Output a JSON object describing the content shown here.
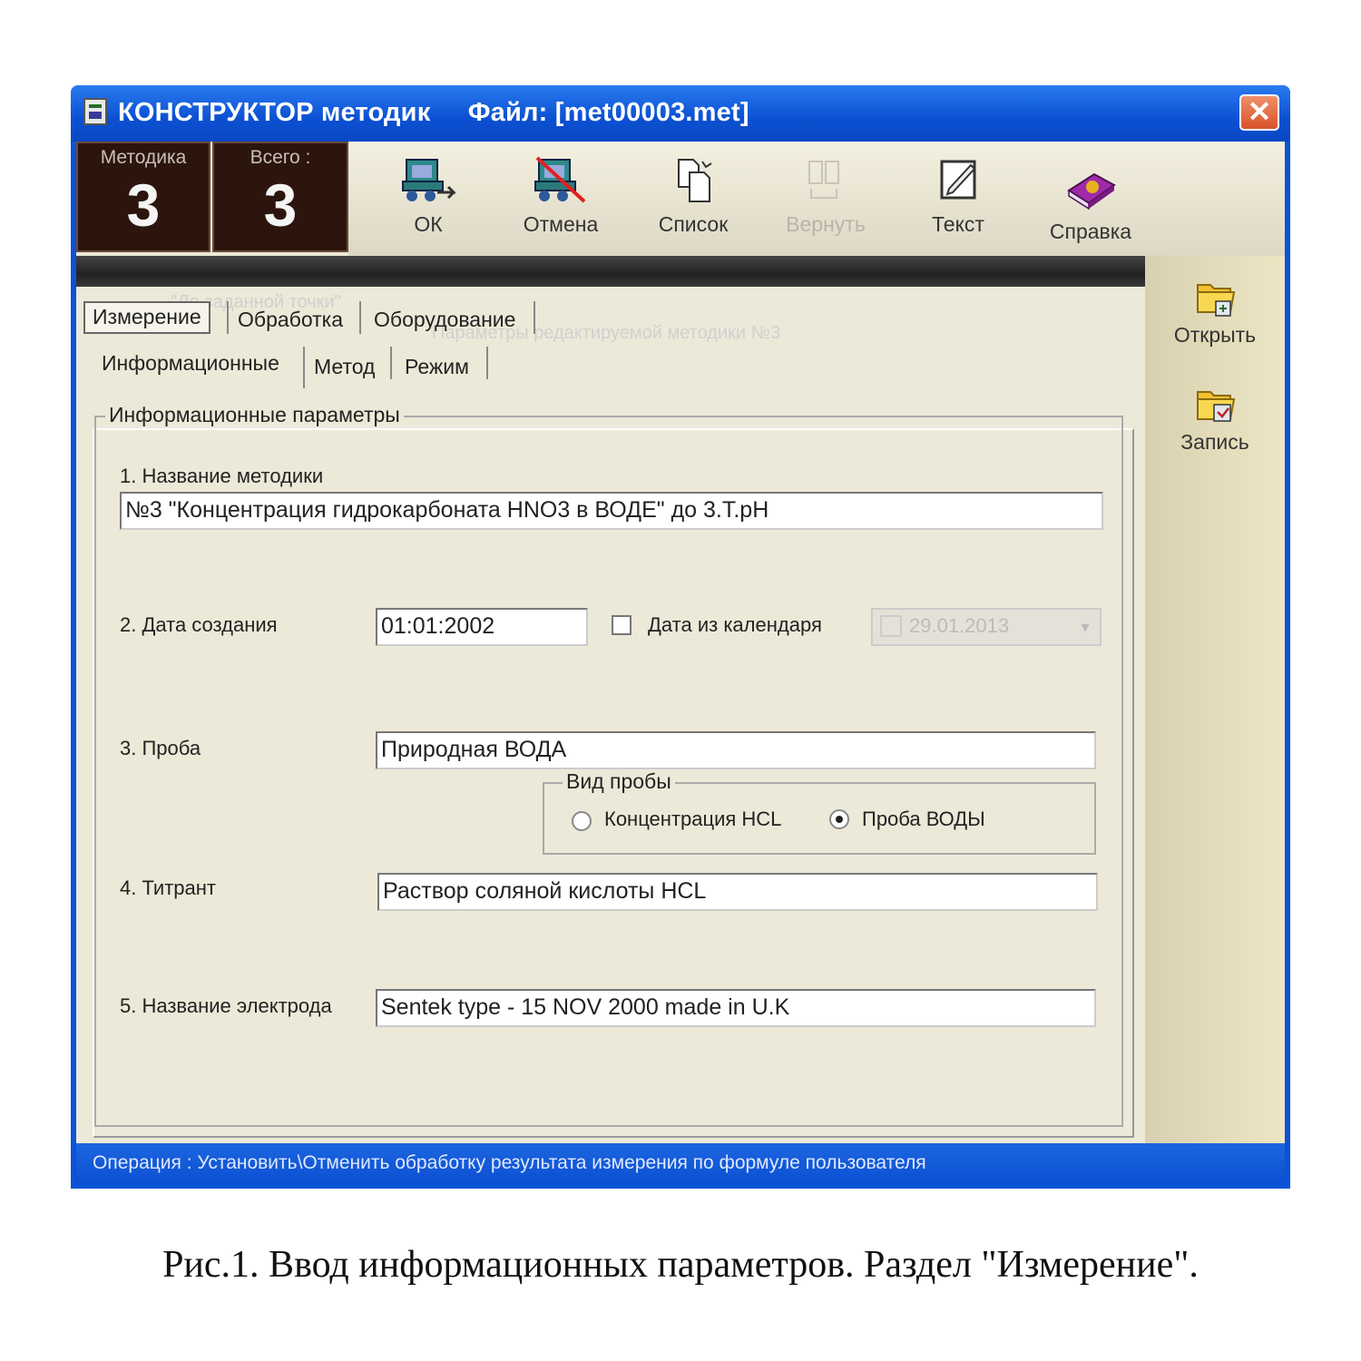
{
  "window": {
    "title": "КОНСТРУКТОР методик     Файл: [met00003.met]",
    "close_glyph": "✕"
  },
  "counters": {
    "method": {
      "label": "Методика",
      "value": "3"
    },
    "total": {
      "label": "Всего :",
      "value": "3"
    }
  },
  "toolbar": {
    "ok": "ОК",
    "cancel": "Отмена",
    "list": "Список",
    "restore": "Вернуть",
    "text": "Текст",
    "help": "Справка"
  },
  "infobar": {
    "mode": "\"До заданной точки\"",
    "text": "Параметры редактируемой методики №3"
  },
  "side": {
    "open": "Открыть",
    "save": "Запись"
  },
  "tabs": {
    "top": [
      "Измерение",
      "Обработка",
      "Оборудование"
    ],
    "sub": [
      "Информационные",
      "Метод",
      "Режим"
    ]
  },
  "form": {
    "group_title": "Информационные параметры",
    "name_label": "1. Название методики",
    "name_value": "№3 \"Концентрация гидрокарбоната HNO3 в ВОДЕ\" до 3.Т.pH",
    "date_label": "2. Дата создания",
    "date_value": "01:01:2002",
    "calendar_label": "Дата из календаря",
    "calendar_value": "29.01.2013",
    "sample_label": "3. Проба",
    "sample_value": "Природная ВОДА",
    "sample_type_title": "Вид пробы",
    "sample_type_options": [
      "Концентрация HCL",
      "Проба ВОДЫ"
    ],
    "titrant_label": "4. Титрант",
    "titrant_value": "Раствор соляной кислоты HCL",
    "electrode_label": "5. Название электрода",
    "electrode_value": "Sentek type - 15 NOV 2000 made in U.K"
  },
  "status": "Операция : Установить\\Отменить обработку результата измерения по формуле пользователя",
  "caption": "Рис.1. Ввод информационных параметров. Раздел \"Измерение\".",
  "colors": {
    "titlebar": "#0b53d6",
    "counter_bg": "#2c150c",
    "client_bg": "#ece9d8"
  }
}
